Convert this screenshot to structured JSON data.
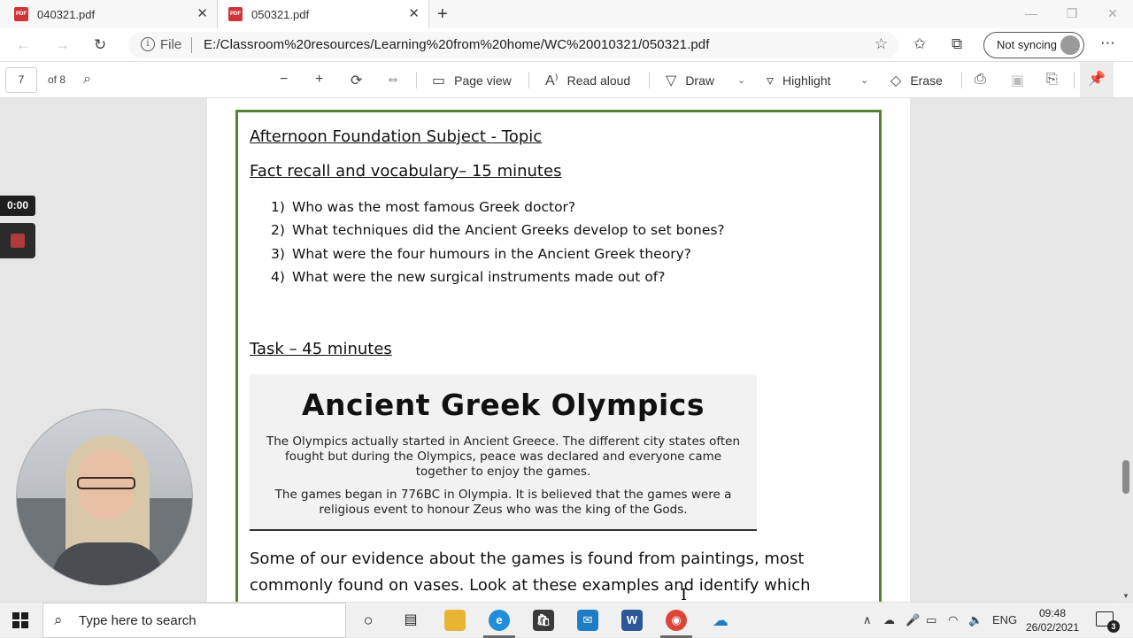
{
  "tabs": [
    {
      "title": "040321.pdf"
    },
    {
      "title": "050321.pdf"
    }
  ],
  "address": {
    "scheme_label": "File",
    "url": "E:/Classroom%20resources/Learning%20from%20home/WC%20010321/050321.pdf",
    "sync_label": "Not syncing"
  },
  "pdf_toolbar": {
    "page_number": "7",
    "page_total": "of 8",
    "page_view": "Page view",
    "read_aloud": "Read aloud",
    "draw": "Draw",
    "highlight": "Highlight",
    "erase": "Erase"
  },
  "recorder": {
    "time": "0:00"
  },
  "document": {
    "heading": "Afternoon Foundation Subject  - Topic",
    "subheading": "Fact recall and vocabulary– 15 minutes",
    "questions": [
      {
        "num": "1)",
        "text": "Who was the most famous Greek doctor?"
      },
      {
        "num": "2)",
        "text": "What techniques did the Ancient Greeks develop to set bones?"
      },
      {
        "num": "3)",
        "text": "What were the four humours in the Ancient Greek theory?"
      },
      {
        "num": "4)",
        "text": "What were the new surgical instruments made out of?"
      }
    ],
    "task_heading": "Task – 45 minutes",
    "banner": {
      "title": "Ancient Greek Olympics",
      "para1": "The Olympics actually started in Ancient Greece. The different city states often fought but during the Olympics, peace was declared and everyone came together to enjoy the games.",
      "para2": "The games began in 776BC in Olympia. It is believed that the games were a religious event to honour Zeus who was the king of the Gods."
    },
    "body": "Some of our evidence about the games is found from paintings, most commonly found on vases. Look at these examples and identify which Olympic sport is being"
  },
  "taskbar": {
    "search_placeholder": "Type here to search",
    "language": "ENG",
    "time": "09:48",
    "date": "26/02/2021",
    "notification_count": "3"
  }
}
